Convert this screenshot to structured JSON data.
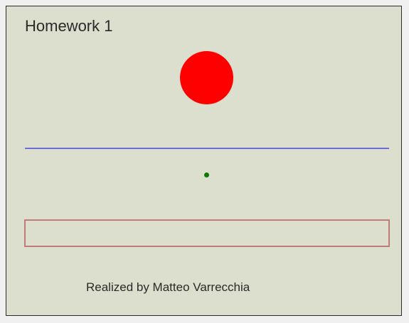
{
  "page": {
    "title": "Homework 1",
    "credit": "Realized by Matteo Varrecchia"
  },
  "colors": {
    "background": "#dcdfce",
    "ball": "#ff0000",
    "line": "#6f6fd9",
    "dot": "#0a7a0a",
    "field_border": "#c07a78"
  }
}
